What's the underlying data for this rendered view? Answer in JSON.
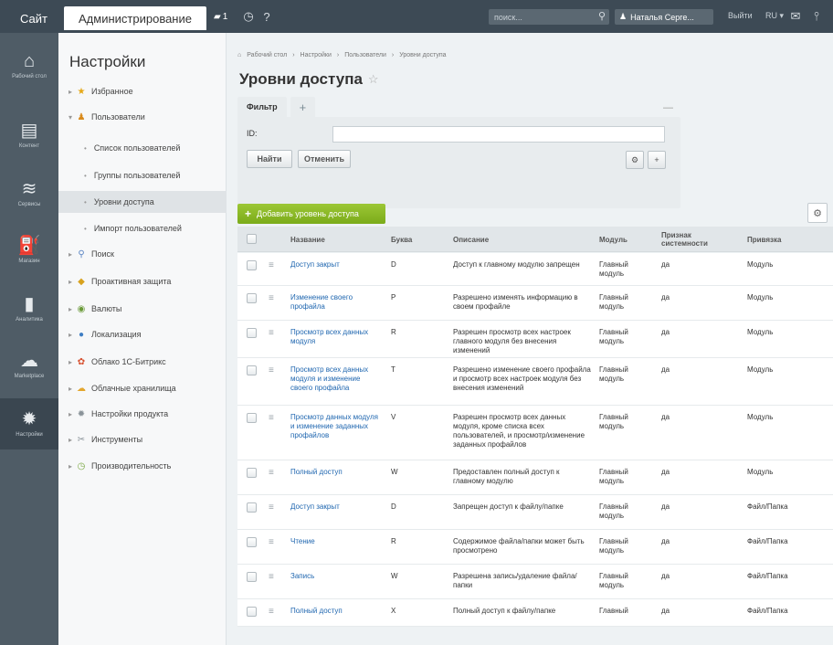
{
  "topbar": {
    "site_tab": "Сайт",
    "admin_tab": "Администрирование",
    "notif_count": "1",
    "search_placeholder": "поиск...",
    "user_name": "Наталья Серге...",
    "logout": "Выйти",
    "lang": "RU"
  },
  "leftnav": [
    {
      "label": "Рабочий стол",
      "icon": "house-icon",
      "glyph": "⌂"
    },
    {
      "label": "Контент",
      "icon": "document-icon",
      "glyph": "▤"
    },
    {
      "label": "Сервисы",
      "icon": "layers-icon",
      "glyph": "≋"
    },
    {
      "label": "Магазин",
      "icon": "shop-icon",
      "glyph": "⛽"
    },
    {
      "label": "Аналитика",
      "icon": "chart-icon",
      "glyph": "▮"
    },
    {
      "label": "Marketplace",
      "icon": "cloud-icon",
      "glyph": "☁"
    },
    {
      "label": "Настройки",
      "icon": "gear-icon",
      "glyph": "✹"
    }
  ],
  "settings": {
    "title": "Настройки",
    "items": [
      {
        "label": "Избранное",
        "glyph": "★",
        "color": "#e6a817",
        "level": 0
      },
      {
        "label": "Пользователи",
        "glyph": "♟",
        "color": "#d98a1c",
        "level": 0
      },
      {
        "label": "Список пользователей",
        "level": 1
      },
      {
        "label": "Группы пользователей",
        "level": 1
      },
      {
        "label": "Уровни доступа",
        "level": 1,
        "active": true
      },
      {
        "label": "Импорт пользователей",
        "level": 1
      },
      {
        "label": "Поиск",
        "glyph": "⚲",
        "color": "#5b86c4",
        "level": 0
      },
      {
        "label": "Проактивная защита",
        "glyph": "◆",
        "color": "#d8a21e",
        "level": 0
      },
      {
        "label": "Валюты",
        "glyph": "◉",
        "color": "#6b9b3a",
        "level": 0
      },
      {
        "label": "Локализация",
        "glyph": "●",
        "color": "#3f7ec4",
        "level": 0
      },
      {
        "label": "Облако 1С-Битрикс",
        "glyph": "✿",
        "color": "#d6502f",
        "level": 0
      },
      {
        "label": "Облачные хранилища",
        "glyph": "☁",
        "color": "#e3a62e",
        "level": 0
      },
      {
        "label": "Настройки продукта",
        "glyph": "✹",
        "color": "#8a9399",
        "level": 0
      },
      {
        "label": "Инструменты",
        "glyph": "✂",
        "color": "#8a9399",
        "level": 0
      },
      {
        "label": "Производительность",
        "glyph": "◷",
        "color": "#7aa843",
        "level": 0
      }
    ]
  },
  "breadcrumb": [
    "Рабочий стол",
    "Настройки",
    "Пользователи",
    "Уровни доступа"
  ],
  "page_title": "Уровни доступа",
  "filter": {
    "tab_label": "Фильтр",
    "id_label": "ID:",
    "find_btn": "Найти",
    "cancel_btn": "Отменить"
  },
  "add_button": "Добавить уровень доступа",
  "table": {
    "headers": [
      "Название",
      "Буква",
      "Описание",
      "Модуль",
      "Признак системности",
      "Привязка"
    ],
    "rows": [
      {
        "name": "Доступ закрыт",
        "letter": "D",
        "desc": "Доступ к главному модулю запрещен",
        "module": "Главный модуль",
        "system": "да",
        "binding": "Модуль"
      },
      {
        "name": "Изменение своего профайла",
        "letter": "P",
        "desc": "Разрешено изменять информацию в своем профайле",
        "module": "Главный модуль",
        "system": "да",
        "binding": "Модуль"
      },
      {
        "name": "Просмотр всех данных модуля",
        "letter": "R",
        "desc": "Разрешен просмотр всех настроек главного модуля без внесения изменений",
        "module": "Главный модуль",
        "system": "да",
        "binding": "Модуль"
      },
      {
        "name": "Просмотр всех данных модуля и изменение своего профайла",
        "letter": "T",
        "desc": "Разрешено изменение своего профайла и просмотр всех настроек модуля без внесения изменений",
        "module": "Главный модуль",
        "system": "да",
        "binding": "Модуль"
      },
      {
        "name": "Просмотр данных модуля и изменение заданных профайлов",
        "letter": "V",
        "desc": "Разрешен просмотр всех данных модуля, кроме списка всех пользователей, и просмотр/изменение заданных профайлов",
        "module": "Главный модуль",
        "system": "да",
        "binding": "Модуль"
      },
      {
        "name": "Полный доступ",
        "letter": "W",
        "desc": "Предоставлен полный доступ к главному модулю",
        "module": "Главный модуль",
        "system": "да",
        "binding": "Модуль"
      },
      {
        "name": "Доступ закрыт",
        "letter": "D",
        "desc": "Запрещен доступ к файлу/папке",
        "module": "Главный модуль",
        "system": "да",
        "binding": "Файл/Папка"
      },
      {
        "name": "Чтение",
        "letter": "R",
        "desc": "Содержимое файла/папки может быть просмотрено",
        "module": "Главный модуль",
        "system": "да",
        "binding": "Файл/Папка"
      },
      {
        "name": "Запись",
        "letter": "W",
        "desc": "Разрешена запись/удаление файла/папки",
        "module": "Главный модуль",
        "system": "да",
        "binding": "Файл/Папка"
      },
      {
        "name": "Полный доступ",
        "letter": "X",
        "desc": "Полный доступ к файлу/папке",
        "module": "Главный",
        "system": "да",
        "binding": "Файл/Папка"
      }
    ]
  },
  "colors": {
    "topbar": "#3d4a55",
    "leftnav": "#4f5c66",
    "accent_green": "#8bb928",
    "link": "#2067b0"
  }
}
